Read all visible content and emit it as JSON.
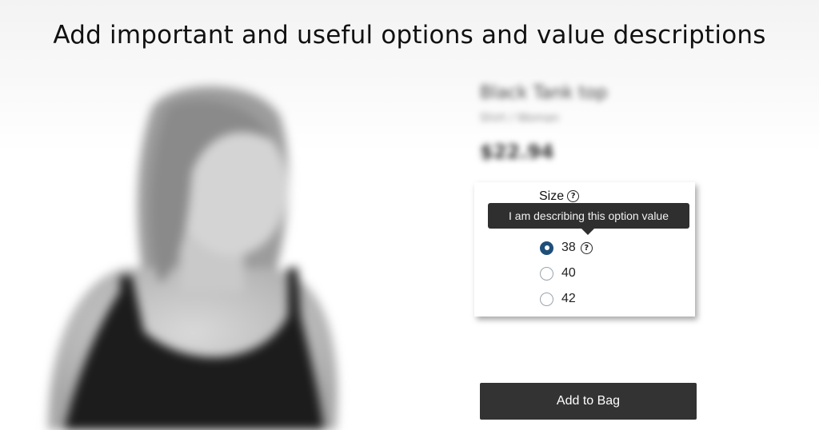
{
  "headline": "Add important and useful options and value descriptions",
  "product": {
    "name": "Black Tank top",
    "subtitle": "Shirt / Woman",
    "price": "$22.94",
    "image_icon": "model-photo"
  },
  "options": {
    "label": "Size",
    "help_icon": "question-circle-icon",
    "tooltip": "I am describing this option value",
    "values": [
      {
        "label": "38",
        "selected": true
      },
      {
        "label": "40",
        "selected": false
      },
      {
        "label": "42",
        "selected": false
      }
    ]
  },
  "add_to_bag": "Add to Bag",
  "colors": {
    "selected_radio": "#1f4e79",
    "button_bg": "#333333",
    "tooltip_bg": "#2f2f2f"
  }
}
